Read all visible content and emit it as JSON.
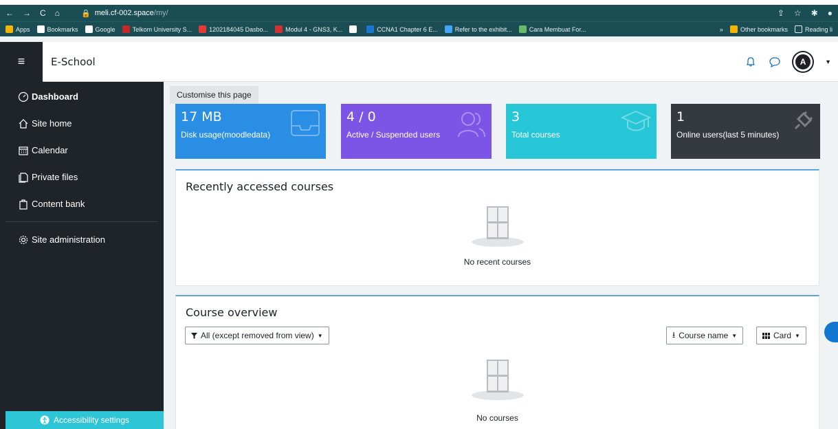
{
  "browser": {
    "url_host": "meli.cf-002.space",
    "url_path": "/my/",
    "bookmarks": [
      {
        "label": "Apps",
        "color": "#f4b400"
      },
      {
        "label": "Bookmarks",
        "color": "#ffffff"
      },
      {
        "label": "Google",
        "color": "#ffffff"
      },
      {
        "label": "Telkom University S...",
        "color": "#c62828"
      },
      {
        "label": "1202184045 Dasbo...",
        "color": "#e53935"
      },
      {
        "label": "Modul 4 - GNS3, K...",
        "color": "#d32f2f"
      },
      {
        "label": "",
        "color": "#ffffff"
      },
      {
        "label": "CCNA1 Chapter 6 E...",
        "color": "#1976d2"
      },
      {
        "label": "Refer to the exhibit...",
        "color": "#42a5f5"
      },
      {
        "label": "Cara Membuat For...",
        "color": "#66bb6a"
      }
    ],
    "more": "»",
    "other_bookmarks": "Other bookmarks",
    "reading_list": "Reading li"
  },
  "header": {
    "brand": "E-School",
    "avatar_letter": "A"
  },
  "sidebar": {
    "items": [
      {
        "label": "Dashboard",
        "icon": "dashboard-icon"
      },
      {
        "label": "Site home",
        "icon": "home-icon"
      },
      {
        "label": "Calendar",
        "icon": "calendar-icon"
      },
      {
        "label": "Private files",
        "icon": "files-icon"
      },
      {
        "label": "Content bank",
        "icon": "content-bank-icon"
      },
      {
        "label": "Site administration",
        "icon": "gear-icon"
      }
    ],
    "accessibility": "Accessibility settings"
  },
  "main": {
    "customise": "Customise this page",
    "cards": [
      {
        "value": "17 MB",
        "label": "Disk usage(moodledata)",
        "color": "#2a8fe4"
      },
      {
        "value": "4 / 0",
        "label": "Active / Suspended users",
        "color": "#7d55e6"
      },
      {
        "value": "3",
        "label": "Total courses",
        "color": "#27c6d6"
      },
      {
        "value": "1",
        "label": "Online users(last 5 minutes)",
        "color": "#343a40"
      }
    ],
    "recent": {
      "title": "Recently accessed courses",
      "empty": "No recent courses"
    },
    "overview": {
      "title": "Course overview",
      "filter": "All (except removed from view)",
      "sort": "Course name",
      "view": "Card",
      "empty": "No courses"
    }
  }
}
